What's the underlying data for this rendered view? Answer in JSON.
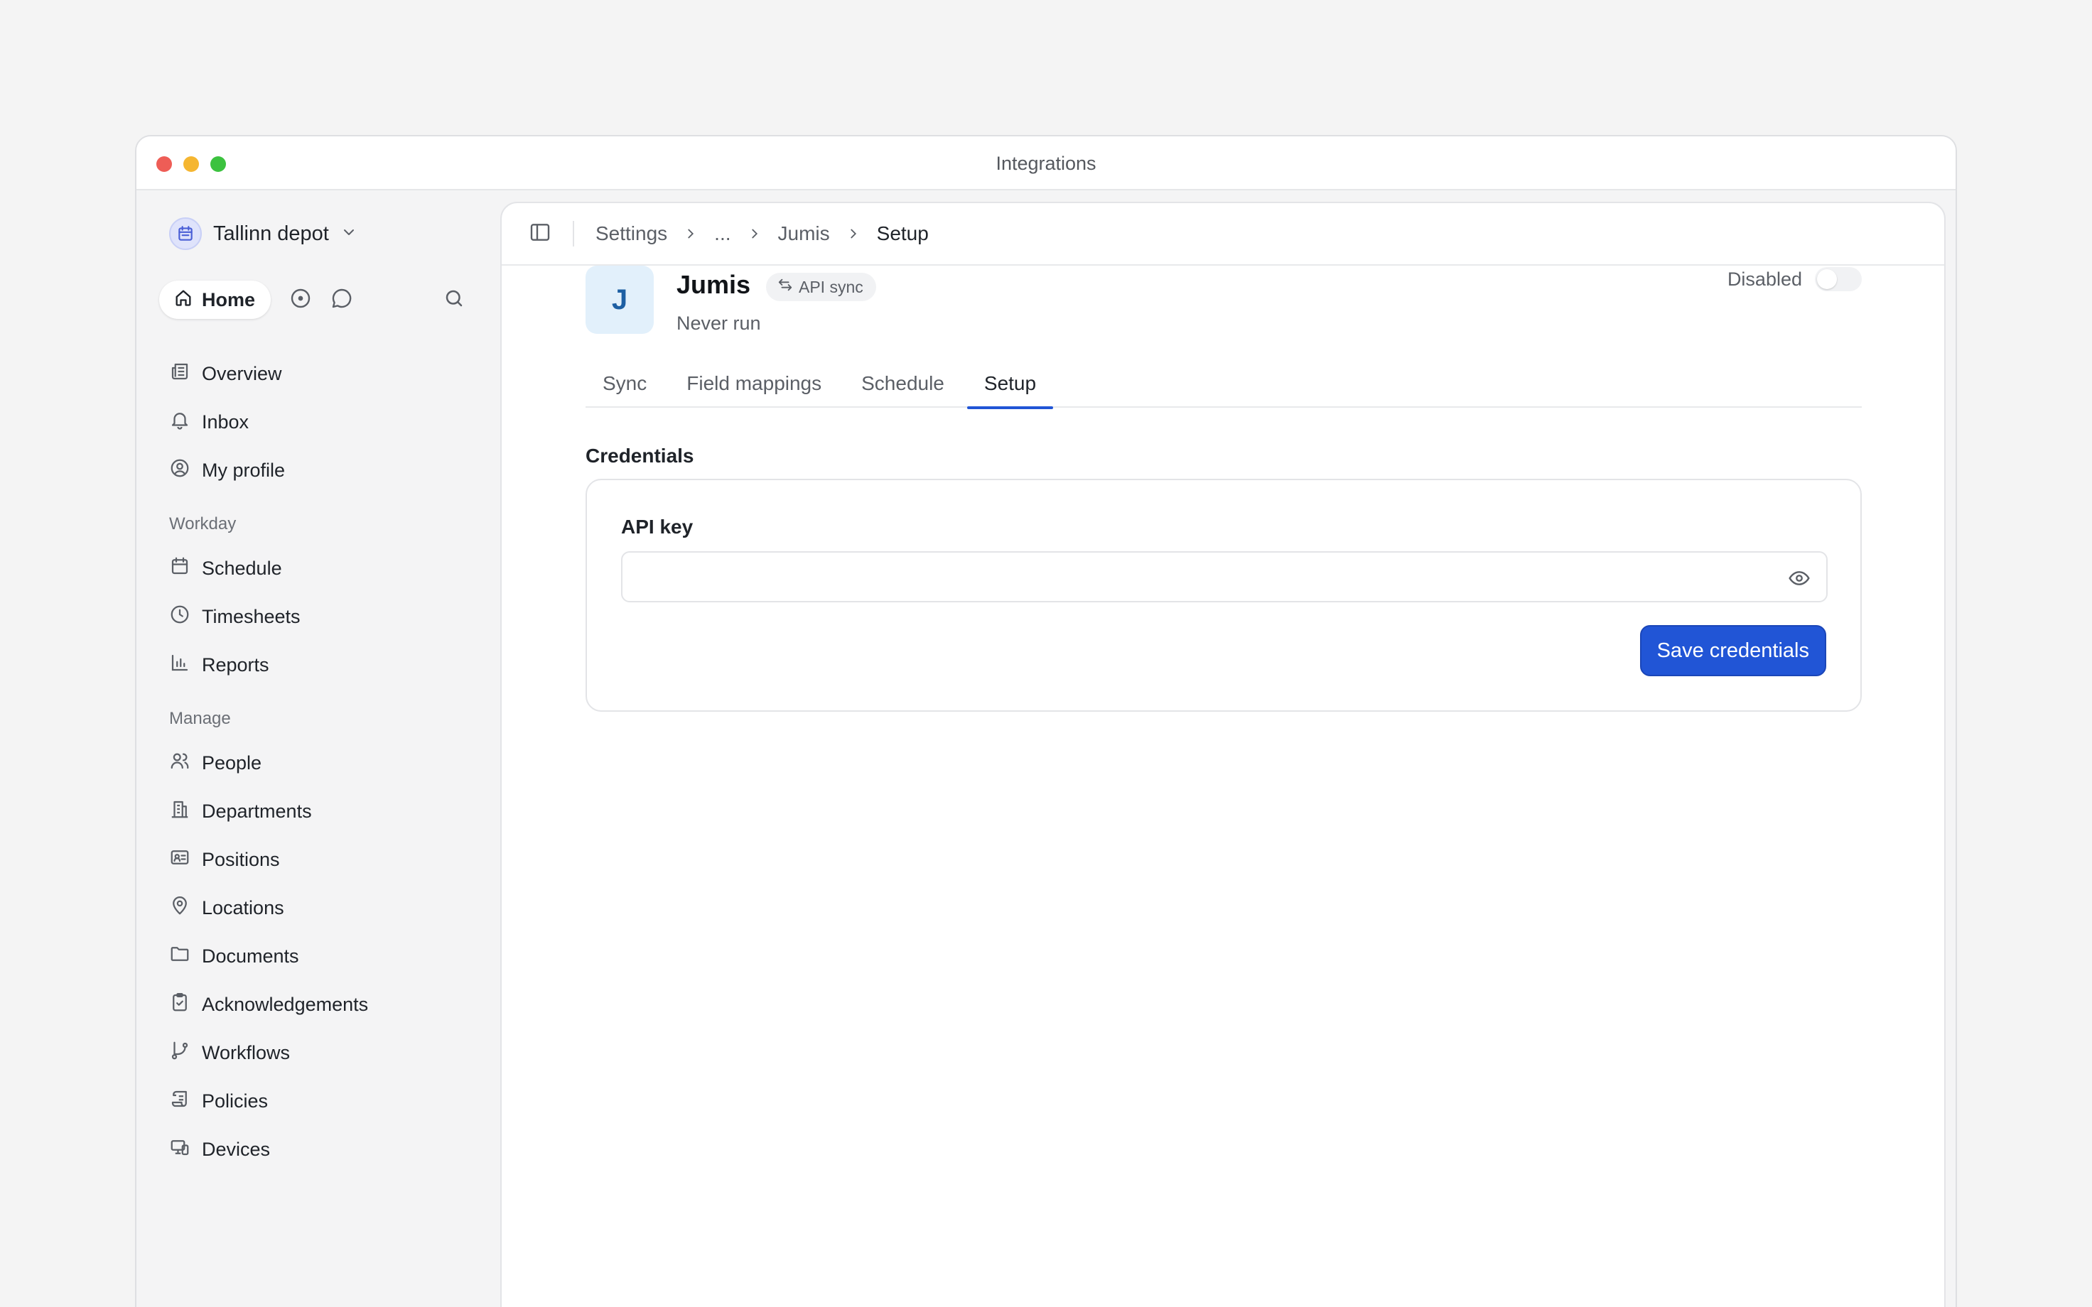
{
  "window": {
    "title": "Integrations"
  },
  "workspace": {
    "name": "Tallinn depot"
  },
  "quick": {
    "home_label": "Home"
  },
  "nav": {
    "primary": [
      {
        "label": "Overview",
        "icon": "newspaper-icon"
      },
      {
        "label": "Inbox",
        "icon": "bell-icon"
      },
      {
        "label": "My profile",
        "icon": "user-circle-icon"
      }
    ],
    "sections": [
      {
        "label": "Workday",
        "items": [
          {
            "label": "Schedule",
            "icon": "calendar-icon"
          },
          {
            "label": "Timesheets",
            "icon": "clock-icon"
          },
          {
            "label": "Reports",
            "icon": "bar-chart-icon"
          }
        ]
      },
      {
        "label": "Manage",
        "items": [
          {
            "label": "People",
            "icon": "users-icon"
          },
          {
            "label": "Departments",
            "icon": "building-icon"
          },
          {
            "label": "Positions",
            "icon": "id-card-icon"
          },
          {
            "label": "Locations",
            "icon": "map-pin-icon"
          },
          {
            "label": "Documents",
            "icon": "folder-icon"
          },
          {
            "label": "Acknowledgements",
            "icon": "clipboard-check-icon"
          },
          {
            "label": "Workflows",
            "icon": "git-branch-icon"
          },
          {
            "label": "Policies",
            "icon": "scroll-icon"
          },
          {
            "label": "Devices",
            "icon": "devices-icon"
          }
        ]
      }
    ]
  },
  "breadcrumb": [
    "Settings",
    "...",
    "Jumis",
    "Setup"
  ],
  "integration": {
    "avatar_letter": "J",
    "name": "Jumis",
    "badge": "API sync",
    "status": "Never run",
    "toggle_label": "Disabled"
  },
  "tabs": [
    {
      "label": "Sync",
      "active": false
    },
    {
      "label": "Field mappings",
      "active": false
    },
    {
      "label": "Schedule",
      "active": false
    },
    {
      "label": "Setup",
      "active": true
    }
  ],
  "credentials": {
    "title": "Credentials",
    "field_label": "API key",
    "value": "",
    "save_label": "Save credentials"
  },
  "colors": {
    "accent": "#2155d6",
    "avatar_bg": "#e2f0fb",
    "avatar_fg": "#1d5fa3"
  }
}
